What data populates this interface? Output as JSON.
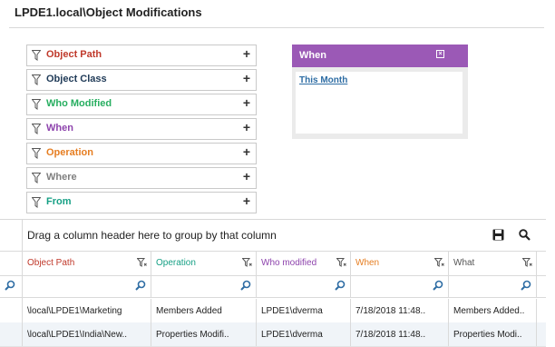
{
  "page": {
    "title": "LPDE1.local\\Object Modifications"
  },
  "filters": [
    {
      "label": "Object Path",
      "color": "#c0392b"
    },
    {
      "label": "Object Class",
      "color": "#1f3a57"
    },
    {
      "label": "Who Modified",
      "color": "#27ae60"
    },
    {
      "label": "When",
      "color": "#8e44ad"
    },
    {
      "label": "Operation",
      "color": "#e67e22"
    },
    {
      "label": "Where",
      "color": "#7f7f7f"
    },
    {
      "label": "From",
      "color": "#16a085"
    }
  ],
  "filter_add_symbol": "+",
  "when_panel": {
    "title": "When",
    "close_symbol": "×",
    "link": "This Month",
    "header_color": "#9b59b6"
  },
  "grid": {
    "group_hint": "Drag a column header here to group by that column",
    "columns": [
      {
        "label": "Object Path",
        "color": "#c0392b"
      },
      {
        "label": "Operation",
        "color": "#16a085"
      },
      {
        "label": "Who modified",
        "color": "#8e44ad"
      },
      {
        "label": "When",
        "color": "#e67e22"
      },
      {
        "label": "What",
        "color": "#555555"
      }
    ],
    "rows": [
      [
        "\\local\\LPDE1\\Marketing",
        "Members Added",
        "LPDE1\\dverma",
        "7/18/2018 11:48..",
        "Members Added.."
      ],
      [
        "\\local\\LPDE1\\India\\New..",
        "Properties Modifi..",
        "LPDE1\\dverma",
        "7/18/2018 11:48..",
        "Properties Modi.."
      ]
    ]
  },
  "icons": {
    "save": "save-icon",
    "search": "search-icon",
    "filter": "funnel-icon"
  }
}
